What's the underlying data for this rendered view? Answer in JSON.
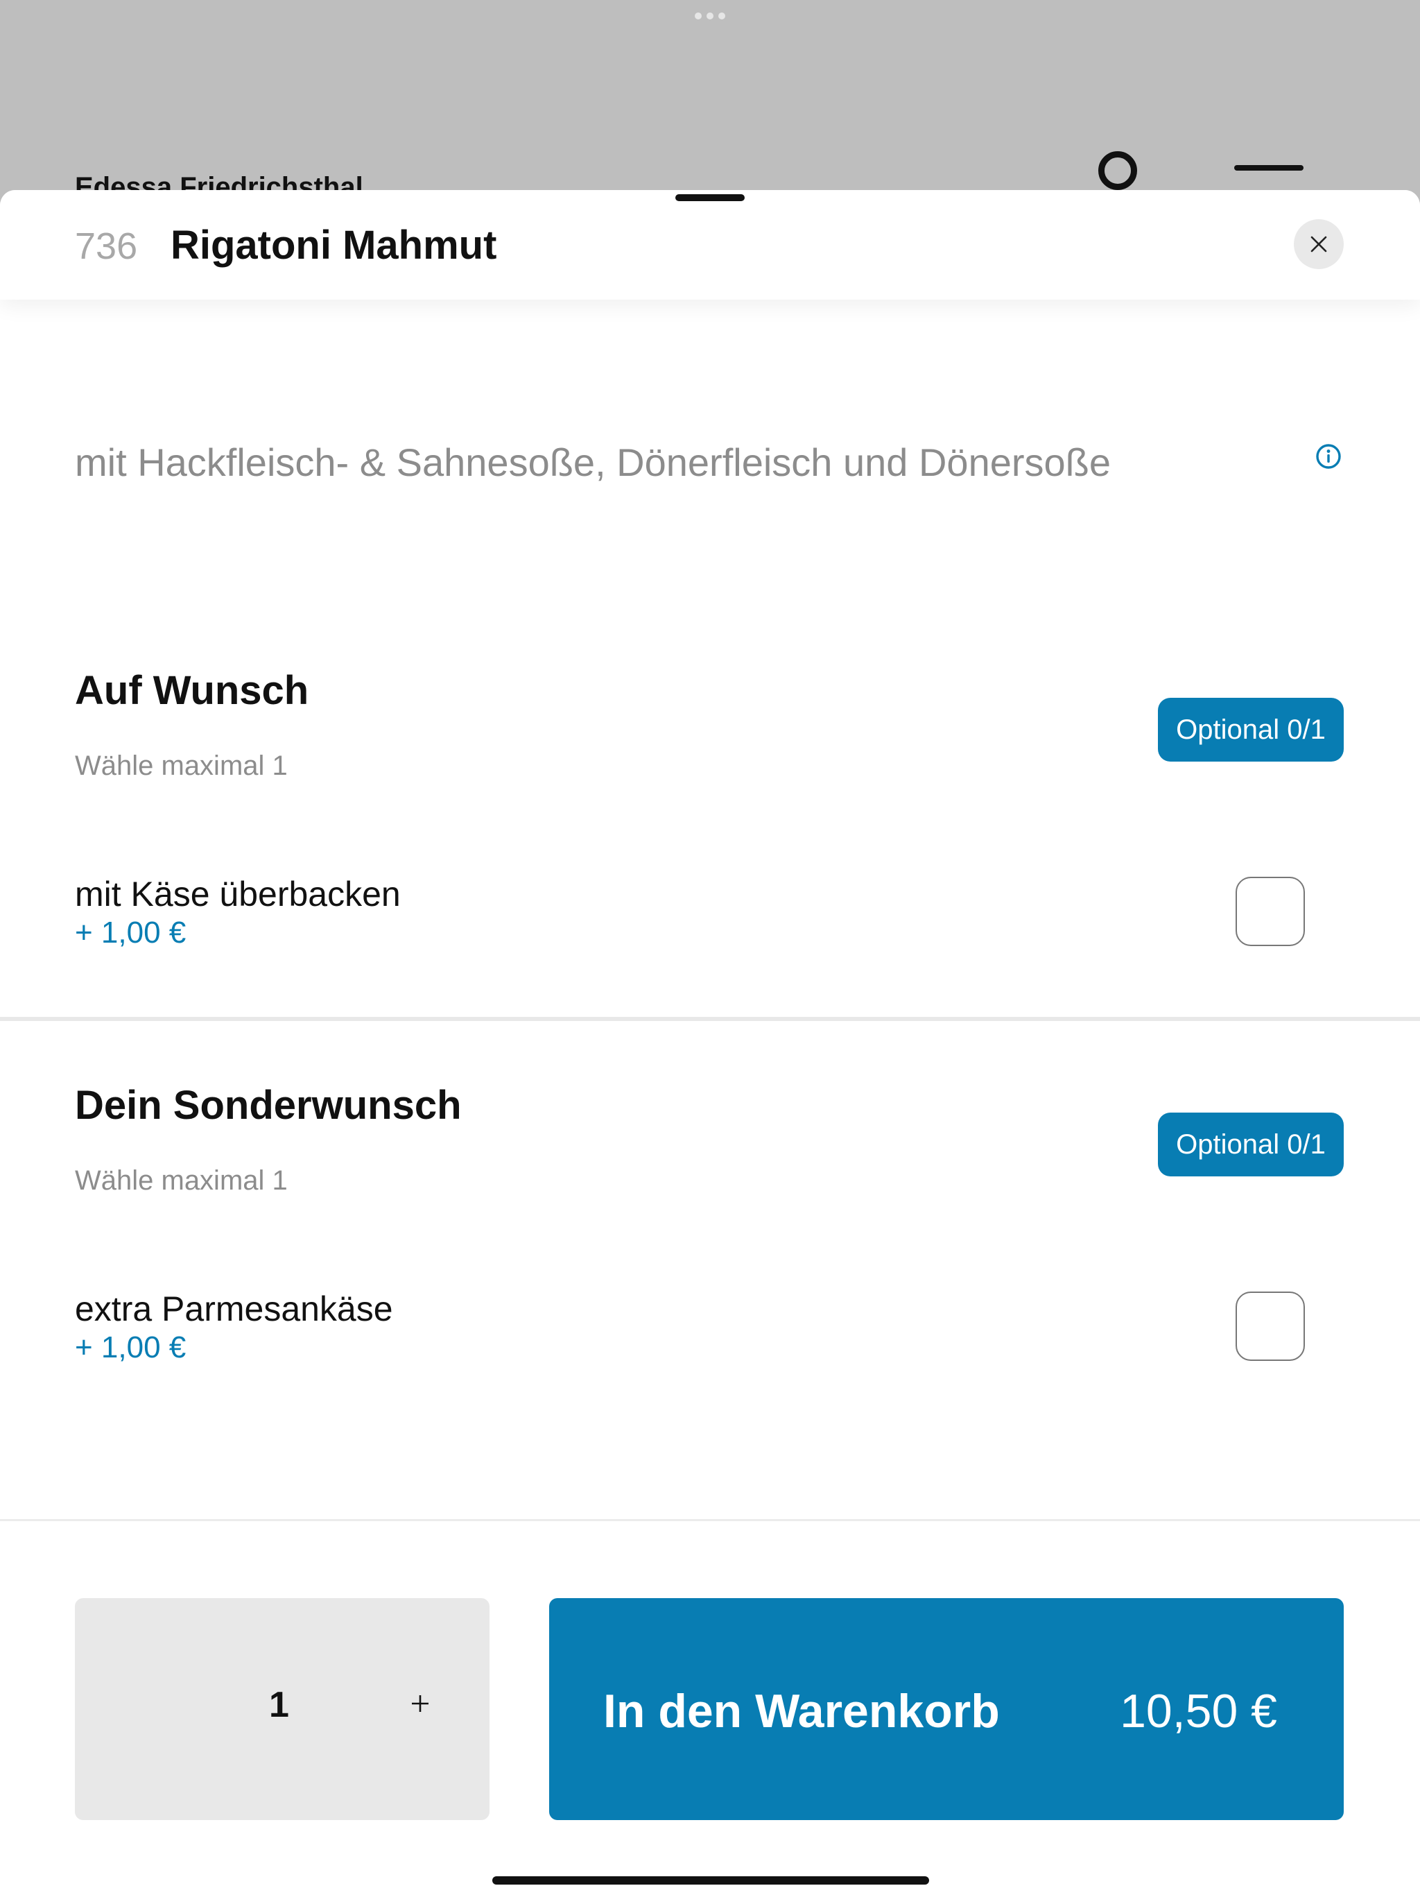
{
  "background": {
    "restaurant_name": "Edessa Friedrichsthal",
    "search_icon": "search-icon",
    "menu_icon": "hamburger-menu-icon"
  },
  "header": {
    "item_number": "736",
    "item_title": "Rigatoni Mahmut",
    "close_icon": "close-icon"
  },
  "description": "mit Hackfleisch- & Sahnesoße, Dönerfleisch und Dönersoße",
  "groups": [
    {
      "title": "Auf Wunsch",
      "subtitle": "Wähle maximal 1",
      "badge": "Optional 0/1",
      "options": [
        {
          "label": "mit Käse überbacken",
          "price": "+ 1,00 €",
          "checked": false
        }
      ]
    },
    {
      "title": "Dein Sonderwunsch",
      "subtitle": "Wähle maximal 1",
      "badge": "Optional 0/1",
      "options": [
        {
          "label": "extra Parmesankäse",
          "price": "+ 1,00 €",
          "checked": false
        }
      ]
    }
  ],
  "footer": {
    "quantity": "1",
    "plus_label": "+",
    "cart_label": "In den Warenkorb",
    "cart_price": "10,50 €"
  },
  "colors": {
    "accent": "#087db3",
    "backdrop": "#bebebe"
  }
}
